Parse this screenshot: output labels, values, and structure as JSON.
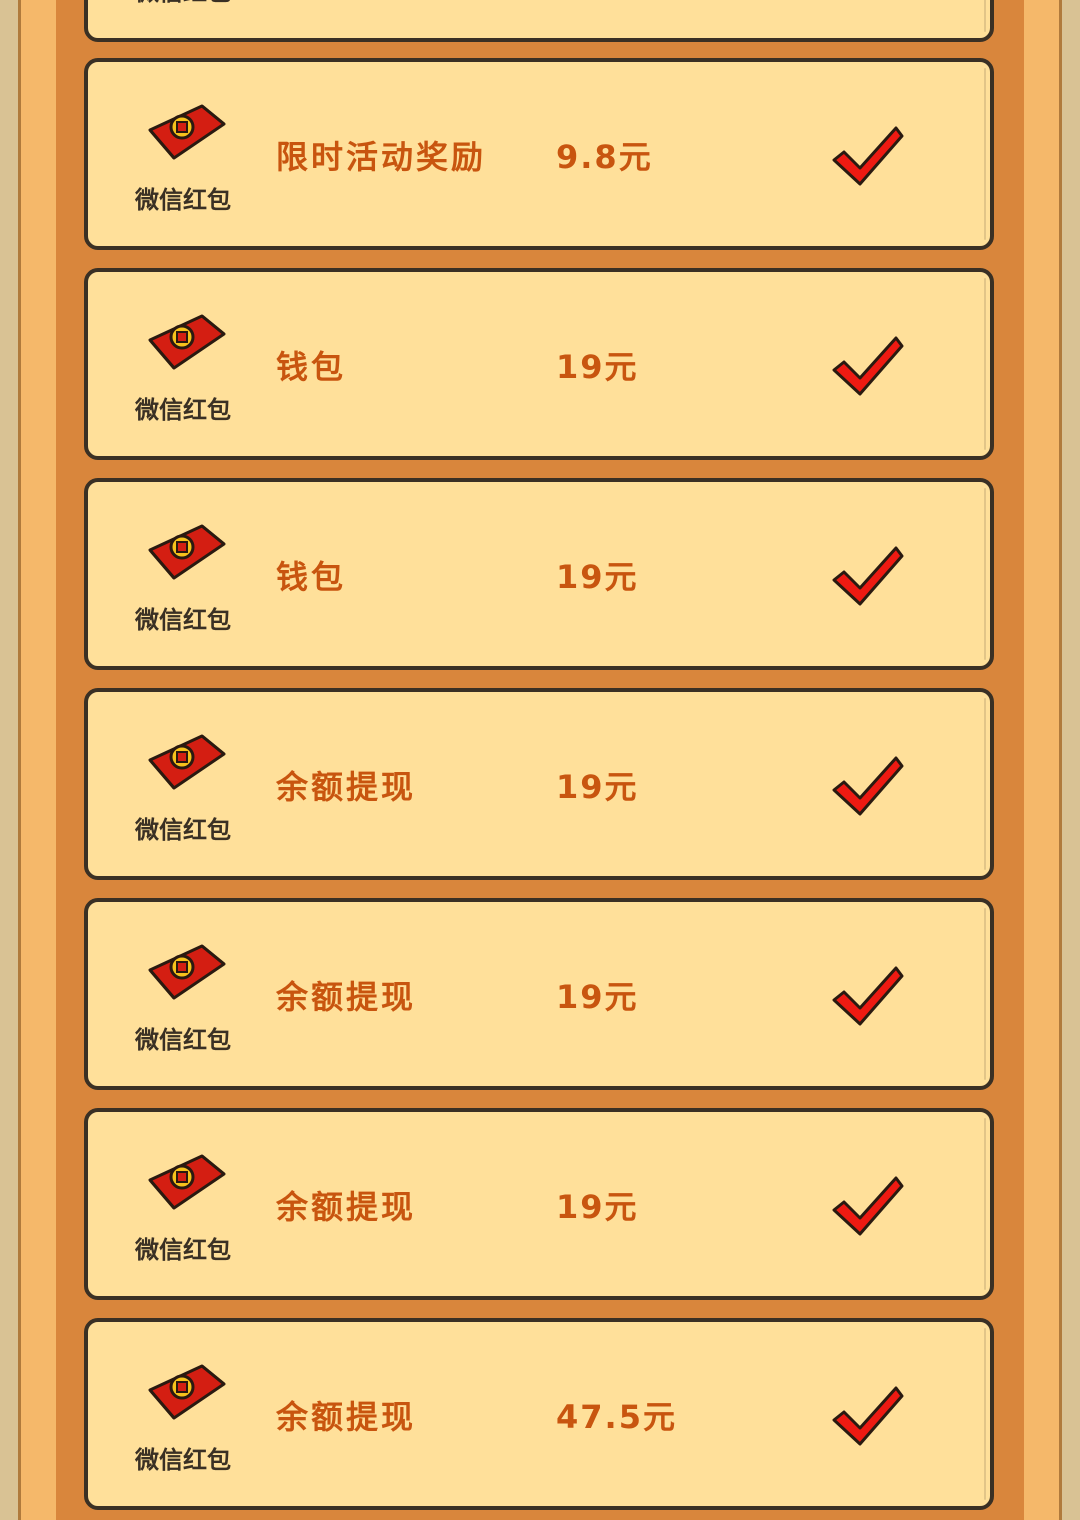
{
  "records": [
    {
      "type_label": "微信红包",
      "reason": "",
      "amount": ""
    },
    {
      "type_label": "微信红包",
      "reason": "限时活动奖励",
      "amount": "9.8元"
    },
    {
      "type_label": "微信红包",
      "reason": "钱包",
      "amount": "19元"
    },
    {
      "type_label": "微信红包",
      "reason": "钱包",
      "amount": "19元"
    },
    {
      "type_label": "微信红包",
      "reason": "余额提现",
      "amount": "19元"
    },
    {
      "type_label": "微信红包",
      "reason": "余额提现",
      "amount": "19元"
    },
    {
      "type_label": "微信红包",
      "reason": "余额提现",
      "amount": "19元"
    },
    {
      "type_label": "微信红包",
      "reason": "余额提现",
      "amount": "47.5元"
    }
  ],
  "icons": {
    "red_packet": "red-packet-icon",
    "status": "checkmark-icon"
  },
  "colors": {
    "accent_text": "#c8550f",
    "card_bg": "#ffe09a",
    "border": "#3a3024",
    "check": "#ee1a12",
    "packet": "#d41e12"
  }
}
